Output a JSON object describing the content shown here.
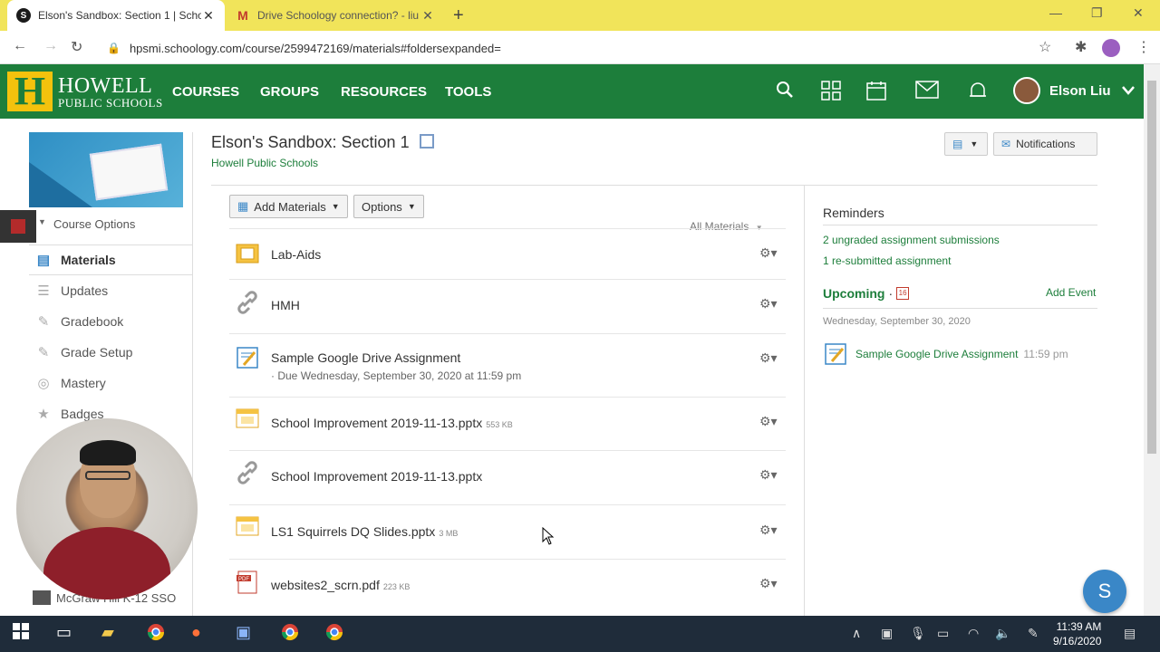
{
  "browser": {
    "tabs": [
      {
        "label": "Elson's Sandbox: Section 1 | Scho",
        "favicon": "S"
      },
      {
        "label": "Drive Schoology connection? - liu",
        "favicon": "M"
      }
    ],
    "url": "hpsmi.schoology.com/course/2599472169/materials#foldersexpanded="
  },
  "header": {
    "logo_line1": "HOWELL",
    "logo_line2": "PUBLIC SCHOOLS",
    "logo_letter": "H",
    "nav": [
      "COURSES",
      "GROUPS",
      "RESOURCES",
      "TOOLS"
    ],
    "user_name": "Elson Liu"
  },
  "course": {
    "title": "Elson's Sandbox: Section 1",
    "school": "Howell Public Schools",
    "options_label": "Course Options",
    "notifications_label": "Notifications"
  },
  "sidebar": {
    "items": [
      {
        "label": "Materials",
        "icon": "materials-icon"
      },
      {
        "label": "Updates",
        "icon": "updates-icon"
      },
      {
        "label": "Gradebook",
        "icon": "gradebook-icon"
      },
      {
        "label": "Grade Setup",
        "icon": "grade-setup-icon"
      },
      {
        "label": "Mastery",
        "icon": "mastery-icon"
      },
      {
        "label": "Badges",
        "icon": "badges-icon"
      }
    ],
    "bottom_item": "McGraw Hill K-12 SSO"
  },
  "toolbar": {
    "add_materials": "Add Materials",
    "options": "Options",
    "all_materials": "All Materials"
  },
  "materials": [
    {
      "name": "Lab-Aids",
      "size": "",
      "due": "",
      "icon": "folder-icon"
    },
    {
      "name": "HMH",
      "size": "",
      "due": "",
      "icon": "link-icon"
    },
    {
      "name": "Sample Google Drive Assignment",
      "size": "",
      "due": "Due Wednesday, September 30, 2020 at 11:59 pm",
      "icon": "assignment-icon"
    },
    {
      "name": "School Improvement 2019-11-13.pptx",
      "size": "553 KB",
      "due": "",
      "icon": "slides-file-icon"
    },
    {
      "name": "School Improvement 2019-11-13.pptx",
      "size": "",
      "due": "",
      "icon": "link-icon"
    },
    {
      "name": "LS1 Squirrels DQ Slides.pptx",
      "size": "3 MB",
      "due": "",
      "icon": "slides-file-icon"
    },
    {
      "name": "websites2_scrn.pdf",
      "size": "223 KB",
      "due": "",
      "icon": "pdf-file-icon"
    }
  ],
  "reminders": {
    "title": "Reminders",
    "items": [
      "2 ungraded assignment submissions",
      "1 re-submitted assignment"
    ]
  },
  "upcoming": {
    "title": "Upcoming",
    "cal_day": "16",
    "add_event": "Add Event",
    "date": "Wednesday, September 30, 2020",
    "item_name": "Sample Google Drive Assignment",
    "item_time": "11:59 pm"
  },
  "chat_letter": "S",
  "taskbar": {
    "time": "11:39 AM",
    "date": "9/16/2020"
  },
  "colors": {
    "brand_green": "#1d7e3b",
    "brand_gold": "#f4c20d",
    "tab_yellow": "#f1e45a"
  }
}
